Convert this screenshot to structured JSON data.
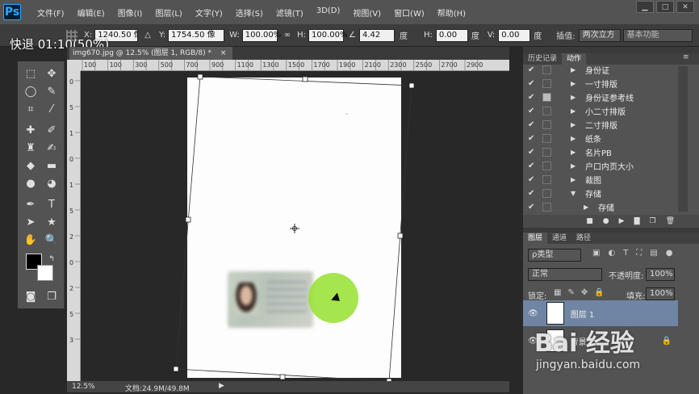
{
  "app": {
    "logo": "Ps"
  },
  "menu": [
    "文件(F)",
    "编辑(E)",
    "图像(I)",
    "图层(L)",
    "文字(Y)",
    "选择(S)",
    "滤镜(T)",
    "3D(D)",
    "视图(V)",
    "窗口(W)",
    "帮助(H)"
  ],
  "window_buttons": [
    "▁",
    "□",
    "✕"
  ],
  "options": {
    "x_label": "X:",
    "x_value": "1240.50 像",
    "y_label": "Y:",
    "y_value": "1754.50 像",
    "w_label": "W:",
    "w_value": "100.00%",
    "h_label": "H:",
    "h_value": "100.00%",
    "angle_value": "4.42",
    "deg": "度",
    "hskew_label": "H:",
    "hskew_value": "0.00",
    "vskew_label": "V:",
    "vskew_value": "0.00",
    "interp_label": "插值:",
    "interp_value": "两次立方",
    "workspace_value": "基本功能"
  },
  "overlay": {
    "text": "快退    01:10(50%)"
  },
  "document": {
    "tab_title": "img670.jpg @ 12.5% (图层 1, RGB/8) *",
    "close": "×"
  },
  "ruler_top": [
    "100",
    "0",
    "100",
    "200",
    "300",
    "400",
    "500",
    "600",
    "700",
    "800",
    "900",
    "1000",
    "1100",
    "1200",
    "1300",
    "1400",
    "1500",
    "1600",
    "1700",
    "1800",
    "1900",
    "2000",
    "2100",
    "2200",
    "2300",
    "2400",
    "2500",
    "2600",
    "2700",
    "2800",
    "2900",
    "3000"
  ],
  "ruler_left": [
    "0",
    "5",
    "1",
    "0",
    "1",
    "5",
    "2",
    "0",
    "2",
    "5",
    "3"
  ],
  "status": {
    "zoom": "12.5%",
    "doc": "文档:24.9M/49.8M"
  },
  "panels": {
    "history_tab": "历史记录",
    "actions_tab": "动作"
  },
  "actions": [
    {
      "label": "身份证"
    },
    {
      "label": "一寸排版"
    },
    {
      "label": "身份证参考线"
    },
    {
      "label": "小二寸排版"
    },
    {
      "label": "二寸排版"
    },
    {
      "label": "纸条"
    },
    {
      "label": "名片PB"
    },
    {
      "label": "户口内页大小"
    },
    {
      "label": "裁图"
    },
    {
      "label": "存储",
      "expanded": true
    },
    {
      "label": "存储",
      "sub": true
    }
  ],
  "layers_panel": {
    "tabs": [
      "图层",
      "通道",
      "路径"
    ],
    "filter_label": "ρ类型",
    "blend_mode": "正常",
    "opacity_label": "不透明度:",
    "opacity_value": "100%",
    "lock_label": "锁定:",
    "fill_label": "填充:",
    "fill_value": "100%",
    "layers": [
      {
        "name": "图层 1",
        "selected": true
      },
      {
        "name": "背景",
        "locked": true
      }
    ]
  },
  "watermark": {
    "text": "Bai 经验",
    "url": "jingyan.baidu.com"
  },
  "colors": {
    "accent": "#31a8ff",
    "selected_layer": "#6f85a3",
    "green_cursor": "#9be23a"
  }
}
